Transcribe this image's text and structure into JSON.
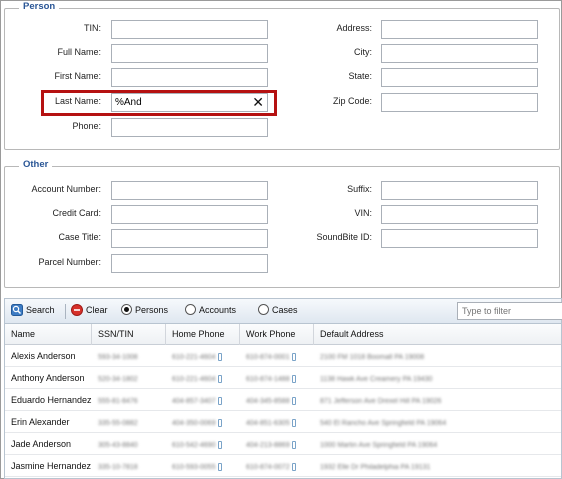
{
  "person": {
    "legend": "Person",
    "fields": {
      "tin": {
        "label": "TIN:",
        "value": ""
      },
      "full_name": {
        "label": "Full Name:",
        "value": ""
      },
      "first_name": {
        "label": "First Name:",
        "value": ""
      },
      "last_name": {
        "label": "Last Name:",
        "value": "%And"
      },
      "phone": {
        "label": "Phone:",
        "value": ""
      },
      "address": {
        "label": "Address:",
        "value": ""
      },
      "city": {
        "label": "City:",
        "value": ""
      },
      "state": {
        "label": "State:",
        "value": ""
      },
      "zip": {
        "label": "Zip Code:",
        "value": ""
      }
    },
    "clear_glyph": "✕"
  },
  "other": {
    "legend": "Other",
    "fields": {
      "account_number": {
        "label": "Account Number:",
        "value": ""
      },
      "credit_card": {
        "label": "Credit Card:",
        "value": ""
      },
      "case_title": {
        "label": "Case Title:",
        "value": ""
      },
      "parcel_number": {
        "label": "Parcel Number:",
        "value": ""
      },
      "suffix": {
        "label": "Suffix:",
        "value": ""
      },
      "vin": {
        "label": "VIN:",
        "value": ""
      },
      "soundbite_id": {
        "label": "SoundBite ID:",
        "value": ""
      }
    }
  },
  "toolbar": {
    "search_label": "Search",
    "clear_label": "Clear",
    "persons_label": "Persons",
    "accounts_label": "Accounts",
    "cases_label": "Cases",
    "selected": "persons",
    "filter_placeholder": "Type to filter"
  },
  "table": {
    "headers": [
      "Name",
      "SSN/TIN",
      "Home Phone",
      "Work Phone",
      "Default Address"
    ],
    "rows": [
      {
        "name": "Alexis Anderson",
        "ssn": "593-34-1008",
        "home": "610-221-4604",
        "work": "610-874-0001",
        "address": "2100 FM 1018 Boomall PA 19008"
      },
      {
        "name": "Anthony Anderson",
        "ssn": "520-34-1802",
        "home": "610-221-4604",
        "work": "610-874-1488",
        "address": "1138 Hawk Ave Creamery PA 19430"
      },
      {
        "name": "Eduardo Hernandez",
        "ssn": "555-81-8476",
        "home": "404-857-3407",
        "work": "404-345-8588",
        "address": "871 Jefferson Ave Drexel Hill PA 19026"
      },
      {
        "name": "Erin Alexander",
        "ssn": "335-55-0882",
        "home": "404-350-0069",
        "work": "404-851-6305",
        "address": "540 El Rancho Ave Springfield PA 19064"
      },
      {
        "name": "Jade Anderson",
        "ssn": "305-43-8840",
        "home": "610-542-4690",
        "work": "404-213-8869",
        "address": "1000 Martin Ave Springfield PA 19064"
      },
      {
        "name": "Jasmine Hernandez",
        "ssn": "335-10-7818",
        "home": "610-593-0055",
        "work": "610-874-0072",
        "address": "1932 Elle Dr Philadelphia PA 19131"
      }
    ]
  }
}
